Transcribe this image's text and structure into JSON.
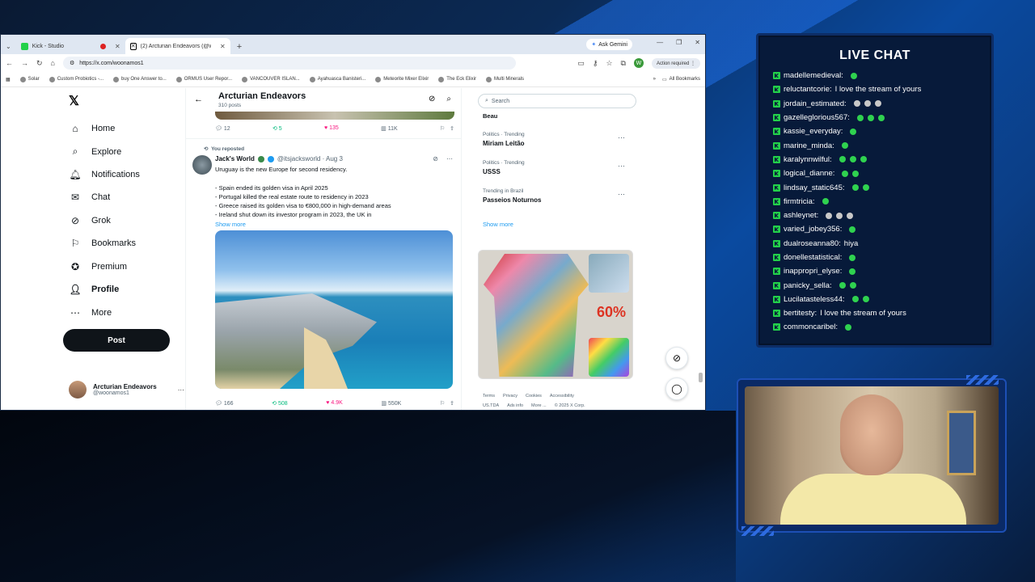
{
  "browser": {
    "tabs": [
      {
        "label": "Kick - Studio",
        "icon_color": "#23d14a",
        "recording": true
      },
      {
        "label": "(2) Arcturian Endeavors (@woo...",
        "icon_color": "#000000",
        "active": true
      }
    ],
    "ask_gemini": "Ask Gemini",
    "url": "https://x.com/woonamos1",
    "profile_initial": "W",
    "action_required": "Action required",
    "bookmarks": [
      "Solar",
      "Custom Probiotics -...",
      "buy One Answer to...",
      "ORMUS User Repor...",
      "VANCOUVER ISLAN...",
      "Ayahuasca Banisteri...",
      "Meteorite Mixer Elixir",
      "The Eck Elixir",
      "Multi Minerals"
    ],
    "all_bookmarks": "All Bookmarks"
  },
  "nav": {
    "logo": "𝕏",
    "items": [
      {
        "label": "Home",
        "icon": "home-icon"
      },
      {
        "label": "Explore",
        "icon": "search-icon"
      },
      {
        "label": "Notifications",
        "icon": "bell-icon"
      },
      {
        "label": "Chat",
        "icon": "chat-icon"
      },
      {
        "label": "Grok",
        "icon": "grok-icon"
      },
      {
        "label": "Bookmarks",
        "icon": "bookmark-icon"
      },
      {
        "label": "Premium",
        "icon": "premium-icon"
      },
      {
        "label": "Profile",
        "icon": "profile-icon"
      },
      {
        "label": "More",
        "icon": "more-icon"
      }
    ],
    "post_button": "Post",
    "account": {
      "name": "Arcturian Endeavors",
      "handle": "@woonamos1"
    }
  },
  "timeline": {
    "title": "Arcturian Endeavors",
    "post_count": "310 posts",
    "prev_actions": {
      "replies": "12",
      "reposts": "5",
      "likes": "135",
      "views": "11K"
    },
    "reposted_label": "You reposted",
    "tweet": {
      "author": "Jack's World",
      "handle_date": "@itsjacksworld · Aug 3",
      "text": "Uruguay is the new Europe for second residency.\n\n- Spain ended its golden visa in April 2025\n- Portugal killed the real estate route to residency in 2023\n- Greece raised its golden visa to €800,000 in high-demand areas\n- Ireland shut down its investor program in 2023, the UK in",
      "show_more": "Show more",
      "actions": {
        "replies": "166",
        "reposts": "508",
        "likes": "4.9K",
        "views": "550K"
      }
    }
  },
  "sidebar": {
    "search_placeholder": "Search",
    "first_trend": "Beau",
    "trends": [
      {
        "category": "Politics · Trending",
        "topic": "Miriam Leitão"
      },
      {
        "category": "Politics · Trending",
        "topic": "USSS"
      },
      {
        "category": "Trending in Brazil",
        "topic": "Passeios Noturnos"
      }
    ],
    "show_more": "Show more",
    "ad_sale": "60%",
    "footer": [
      "Terms",
      "Privacy",
      "Cookies",
      "Accessibility"
    ],
    "footer2": [
      "US.TDA",
      "Ads info",
      "More ...",
      "© 2025 X Corp."
    ]
  },
  "chat": {
    "title": "LIVE CHAT",
    "accent": "#23d14a",
    "messages": [
      {
        "user": "madellemedieval:",
        "body": "",
        "emotes": 1
      },
      {
        "user": "reluctantcorie:",
        "body": "I love the stream of yours",
        "emotes": 0
      },
      {
        "user": "jordain_estimated:",
        "body": "",
        "emotes": 3,
        "emote_style": "gray"
      },
      {
        "user": "gazelleglorious567:",
        "body": "",
        "emotes": 3
      },
      {
        "user": "kassie_everyday:",
        "body": "",
        "emotes": 1
      },
      {
        "user": "marine_minda:",
        "body": "",
        "emotes": 1
      },
      {
        "user": "karalynnwilful:",
        "body": "",
        "emotes": 3
      },
      {
        "user": "logical_dianne:",
        "body": "",
        "emotes": 2
      },
      {
        "user": "lindsay_static645:",
        "body": "",
        "emotes": 2
      },
      {
        "user": "firmtricia:",
        "body": "",
        "emotes": 1
      },
      {
        "user": "ashleynet:",
        "body": "",
        "emotes": 3,
        "emote_style": "gray"
      },
      {
        "user": "varied_jobey356:",
        "body": "",
        "emotes": 1
      },
      {
        "user": "dualroseanna80:",
        "body": "hiya",
        "emotes": 0
      },
      {
        "user": "donellestatistical:",
        "body": "",
        "emotes": 1
      },
      {
        "user": "inappropri_elyse:",
        "body": "",
        "emotes": 1
      },
      {
        "user": "panicky_sella:",
        "body": "",
        "emotes": 2
      },
      {
        "user": "Lucilatasteless44:",
        "body": "",
        "emotes": 2
      },
      {
        "user": "bertitesty:",
        "body": "I love the stream of yours",
        "emotes": 0
      },
      {
        "user": "commoncaribel:",
        "body": "",
        "emotes": 1
      }
    ]
  }
}
